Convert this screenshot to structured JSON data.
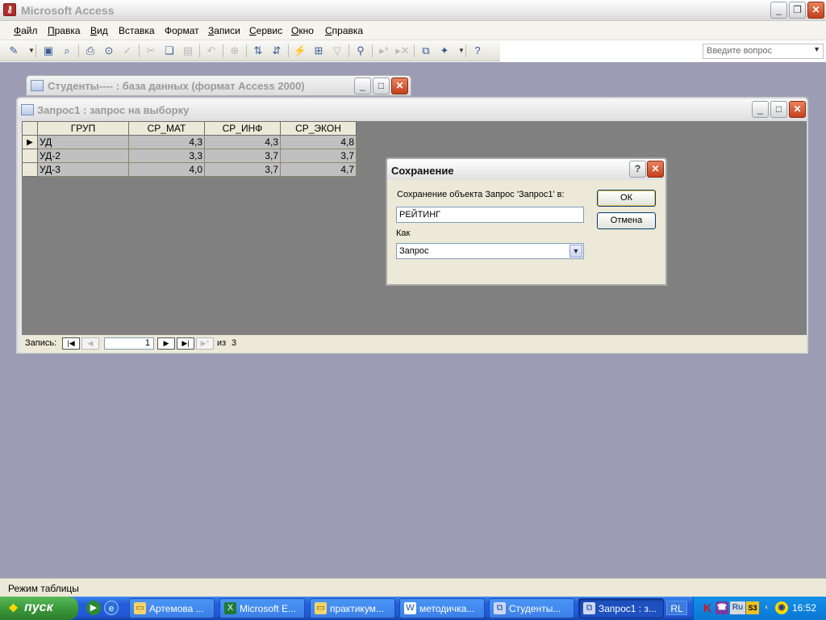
{
  "app": {
    "title": "Microsoft Access",
    "ask_placeholder": "Введите вопрос"
  },
  "menu": {
    "items": [
      {
        "label": "Файл",
        "accel": "Ф",
        "rest": "айл"
      },
      {
        "label": "Правка",
        "accel": "П",
        "rest": "равка"
      },
      {
        "label": "Вид",
        "accel": "В",
        "rest": "ид"
      },
      {
        "label": "Вставка",
        "accel": "",
        "rest": "Вставка"
      },
      {
        "label": "Формат",
        "accel": "",
        "rest": "Формат"
      },
      {
        "label": "Записи",
        "accel": "З",
        "rest": "аписи"
      },
      {
        "label": "Сервис",
        "accel": "С",
        "rest": "ервис"
      },
      {
        "label": "Окно",
        "accel": "О",
        "rest": "кно"
      },
      {
        "label": "Справка",
        "accel": "С",
        "rest": "правка"
      }
    ]
  },
  "db_window": {
    "title": "Студенты---- : база данных (формат Access 2000)"
  },
  "query_window": {
    "title": "Запрос1 : запрос на выборку",
    "columns": [
      "ГРУП",
      "СР_МАТ",
      "СР_ИНФ",
      "СР_ЭКОН"
    ],
    "rows": [
      [
        "УД",
        "4,3",
        "4,3",
        "4,8"
      ],
      [
        "УД-2",
        "3,3",
        "3,7",
        "3,7"
      ],
      [
        "УД-3",
        "4,0",
        "3,7",
        "4,7"
      ]
    ],
    "nav": {
      "label": "Запись:",
      "current": "1",
      "of_label": "из",
      "total": "3"
    }
  },
  "save_dialog": {
    "title": "Сохранение",
    "prompt": "Сохранение объекта Запрос 'Запрос1' в:",
    "name_value": "РЕЙТИНГ",
    "as_label": "Как",
    "as_value": "Запрос",
    "ok_label": "ОК",
    "cancel_label": "Отмена"
  },
  "status": {
    "text": "Режим таблицы"
  },
  "taskbar": {
    "start_label": "пуск",
    "tasks": [
      {
        "label": "Артемова ...",
        "active": false
      },
      {
        "label": "Microsoft E...",
        "active": false
      },
      {
        "label": "практикум...",
        "active": false
      },
      {
        "label": "методичка...",
        "active": false
      },
      {
        "label": "Студенты...",
        "active": false
      },
      {
        "label": "Запрос1 : з...",
        "active": true
      }
    ],
    "lang": "RL",
    "tray_lang": "Ru",
    "clock": "16:52"
  }
}
